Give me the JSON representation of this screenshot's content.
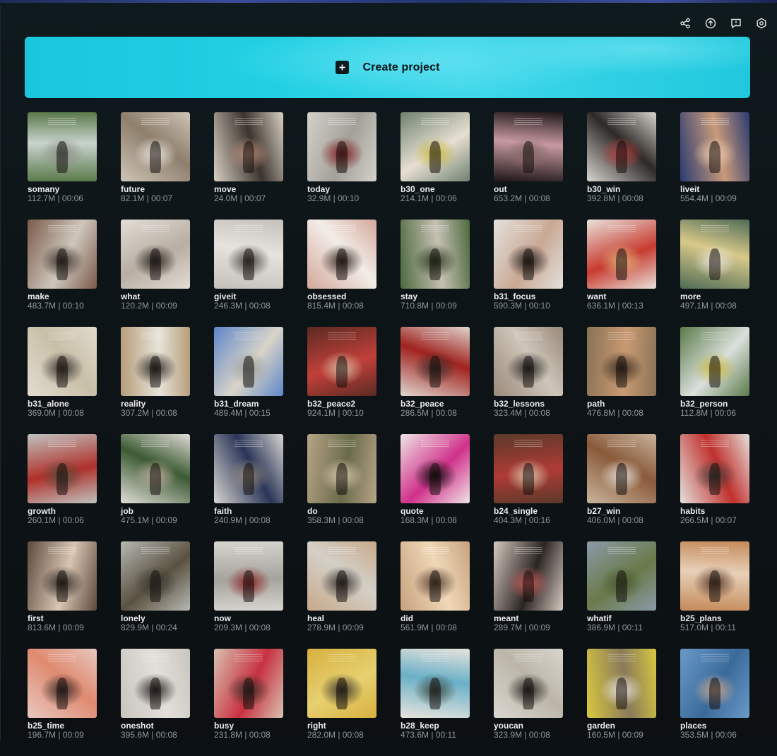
{
  "toolbar": {
    "icons": [
      "share-icon",
      "upload-icon",
      "feedback-icon",
      "settings-icon"
    ]
  },
  "create": {
    "label": "Create project",
    "accent": "#22d0e3"
  },
  "projects": [
    {
      "name": "somany",
      "meta": "112.7M | 00:06",
      "colors": [
        "#5a7a4a",
        "#c9d3cf",
        "#8a8f86"
      ]
    },
    {
      "name": "future",
      "meta": "82.1M | 00:07",
      "colors": [
        "#cfc4b6",
        "#8e7f6d",
        "#e7e2da"
      ]
    },
    {
      "name": "move",
      "meta": "24.0M | 00:07",
      "colors": [
        "#d9cfc2",
        "#3b332e",
        "#b88b78"
      ]
    },
    {
      "name": "today",
      "meta": "32.9M | 00:10",
      "colors": [
        "#d5d1cb",
        "#a39f99",
        "#7d1f20"
      ]
    },
    {
      "name": "b30_one",
      "meta": "214.1M | 00:06",
      "colors": [
        "#6f8270",
        "#e7dfd2",
        "#c7b840"
      ]
    },
    {
      "name": "out",
      "meta": "653.2M | 00:08",
      "colors": [
        "#1e1616",
        "#c79aa2",
        "#8a6a68"
      ]
    },
    {
      "name": "b30_win",
      "meta": "392.8M | 00:08",
      "colors": [
        "#d7d3cf",
        "#2d2926",
        "#b04040"
      ]
    },
    {
      "name": "liveit",
      "meta": "554.4M | 00:09",
      "colors": [
        "#2a3b70",
        "#c89a7b",
        "#e8c6a9"
      ]
    },
    {
      "name": "make",
      "meta": "483.7M | 00:10",
      "colors": [
        "#7a5a4a",
        "#cfc7bd",
        "#3a2f28"
      ]
    },
    {
      "name": "what",
      "meta": "120.2M | 00:09",
      "colors": [
        "#e3ddd6",
        "#b8aea2",
        "#302a26"
      ]
    },
    {
      "name": "giveit",
      "meta": "246.3M | 00:08",
      "colors": [
        "#c3bfba",
        "#e6e3df",
        "#4a4440"
      ]
    },
    {
      "name": "obsessed",
      "meta": "815.4M | 00:08",
      "colors": [
        "#d3a79a",
        "#f2ede8",
        "#3a2b25"
      ]
    },
    {
      "name": "stay",
      "meta": "710.8M | 00:09",
      "colors": [
        "#4d6a3f",
        "#c6c0b2",
        "#2b3a22"
      ]
    },
    {
      "name": "b31_focus",
      "meta": "590.3M | 00:10",
      "colors": [
        "#e4e1dd",
        "#c9a894",
        "#2a221e"
      ]
    },
    {
      "name": "want",
      "meta": "636.1M | 00:13",
      "colors": [
        "#e8e2da",
        "#c83b30",
        "#e0b078"
      ]
    },
    {
      "name": "more",
      "meta": "497.1M | 00:08",
      "colors": [
        "#4e6b55",
        "#d8c98a",
        "#e7e2d8"
      ]
    },
    {
      "name": "b31_alone",
      "meta": "369.0M | 00:08",
      "colors": [
        "#e2dccf",
        "#c9bfa8",
        "#3a342e"
      ]
    },
    {
      "name": "reality",
      "meta": "307.2M | 00:08",
      "colors": [
        "#b59d78",
        "#e8e3da",
        "#2c2824"
      ]
    },
    {
      "name": "b31_dream",
      "meta": "489.4M | 00:15",
      "colors": [
        "#5e86c9",
        "#d9d4c8",
        "#9fa3a0"
      ]
    },
    {
      "name": "b32_peace2",
      "meta": "924.1M | 00:10",
      "colors": [
        "#5a2a22",
        "#c2403a",
        "#d7b9a0"
      ]
    },
    {
      "name": "b32_peace",
      "meta": "286.5M | 00:08",
      "colors": [
        "#e0d6cf",
        "#a0221f",
        "#3c2a26"
      ]
    },
    {
      "name": "b32_lessons",
      "meta": "323.4M | 00:08",
      "colors": [
        "#9a8a7a",
        "#cfc6ba",
        "#2b2826"
      ]
    },
    {
      "name": "path",
      "meta": "476.8M | 00:08",
      "colors": [
        "#8a7256",
        "#c89a72",
        "#3a2c22"
      ]
    },
    {
      "name": "b32_person",
      "meta": "112.8M | 00:06",
      "colors": [
        "#5a7a4a",
        "#dbe0dc",
        "#c7b840"
      ]
    },
    {
      "name": "growth",
      "meta": "260.1M | 00:06",
      "colors": [
        "#bfc3c0",
        "#b0302a",
        "#5a4a3a"
      ]
    },
    {
      "name": "job",
      "meta": "475.1M | 00:09",
      "colors": [
        "#e1ddd8",
        "#3b5a32",
        "#b8a99a"
      ]
    },
    {
      "name": "faith",
      "meta": "240.9M | 00:08",
      "colors": [
        "#d8d6d2",
        "#2a3558",
        "#8f877c"
      ]
    },
    {
      "name": "do",
      "meta": "358.3M | 00:08",
      "colors": [
        "#b7a487",
        "#6a6b4a",
        "#d9c9ac"
      ]
    },
    {
      "name": "quote",
      "meta": "168.3M | 00:08",
      "colors": [
        "#f0e5e6",
        "#d0308a",
        "#111111"
      ]
    },
    {
      "name": "b24_single",
      "meta": "404.3M | 00:16",
      "colors": [
        "#5a3a2a",
        "#b03a35",
        "#d9c3a8"
      ]
    },
    {
      "name": "b27_win",
      "meta": "406.0M | 00:08",
      "colors": [
        "#c9b49c",
        "#8a5a3a",
        "#e3dcd3"
      ]
    },
    {
      "name": "habits",
      "meta": "266.5M | 00:07",
      "colors": [
        "#e4e0db",
        "#c0302d",
        "#4a403a"
      ]
    },
    {
      "name": "first",
      "meta": "813.6M | 00:09",
      "colors": [
        "#5c4a3e",
        "#d9c6b3",
        "#2c2420"
      ]
    },
    {
      "name": "lonely",
      "meta": "829.9M | 00:24",
      "colors": [
        "#b7b8b4",
        "#5a5140",
        "#3b3a34"
      ]
    },
    {
      "name": "now",
      "meta": "209.3M | 00:08",
      "colors": [
        "#d8d5d0",
        "#a6a29c",
        "#8a2424"
      ]
    },
    {
      "name": "heal",
      "meta": "278.9M | 00:09",
      "colors": [
        "#c7a98a",
        "#d4d0c8",
        "#3a3430"
      ]
    },
    {
      "name": "did",
      "meta": "561.9M | 00:08",
      "colors": [
        "#c7a27e",
        "#f0d8b8",
        "#5a4030"
      ]
    },
    {
      "name": "meant",
      "meta": "289.7M | 00:09",
      "colors": [
        "#d7c9c0",
        "#2a2523",
        "#c85a5a"
      ]
    },
    {
      "name": "whatif",
      "meta": "386.9M | 00:11",
      "colors": [
        "#8a9aa8",
        "#6a7a4a",
        "#4a5a30"
      ]
    },
    {
      "name": "b25_plans",
      "meta": "517.0M | 00:11",
      "colors": [
        "#c48a5a",
        "#e8d0b8",
        "#5a3a28"
      ]
    },
    {
      "name": "b25_time",
      "meta": "196.7M | 00:09",
      "colors": [
        "#e8c8c0",
        "#e08a70",
        "#3a2a26"
      ]
    },
    {
      "name": "oneshot",
      "meta": "395.6M | 00:08",
      "colors": [
        "#c8c4be",
        "#e3dfda",
        "#2a2624"
      ]
    },
    {
      "name": "busy",
      "meta": "231.8M | 00:08",
      "colors": [
        "#d8c2b0",
        "#c83040",
        "#3a2e28"
      ]
    },
    {
      "name": "right",
      "meta": "282.0M | 00:08",
      "colors": [
        "#d8b040",
        "#e6d070",
        "#3a3428"
      ]
    },
    {
      "name": "b28_keep",
      "meta": "473.6M | 00:11",
      "colors": [
        "#e7e3dc",
        "#6ab0c8",
        "#3a4a40"
      ]
    },
    {
      "name": "youcan",
      "meta": "323.9M | 00:08",
      "colors": [
        "#d9d6cf",
        "#bcb6a9",
        "#2a2422"
      ]
    },
    {
      "name": "garden",
      "meta": "160.5M | 00:09",
      "colors": [
        "#d8c840",
        "#8a7a5a",
        "#e8e2d8"
      ]
    },
    {
      "name": "places",
      "meta": "353.5M | 00:06",
      "colors": [
        "#6a9ac8",
        "#3a6a9a",
        "#c8a890"
      ]
    }
  ]
}
